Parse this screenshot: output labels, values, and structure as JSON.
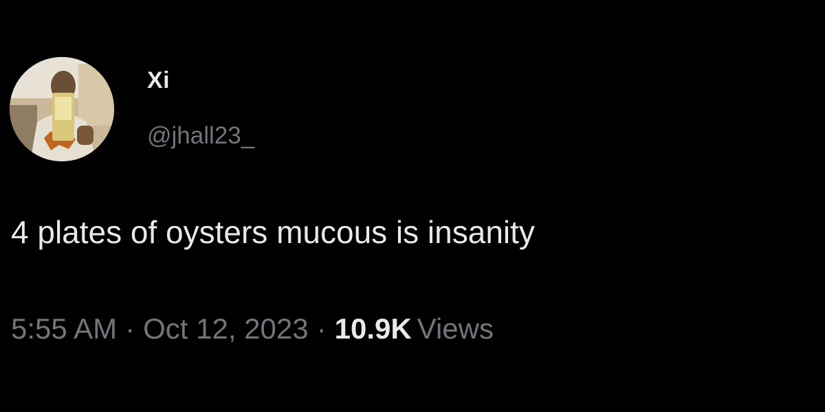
{
  "tweet": {
    "author": {
      "display_name": "Xi",
      "handle": "@jhall23_",
      "avatar_icon": "profile-photo"
    },
    "text": "4 plates of oysters mucous is insanity",
    "meta": {
      "time": "5:55 AM",
      "separator": "·",
      "date": "Oct 12, 2023",
      "views_count": "10.9K",
      "views_label": "Views"
    }
  },
  "colors": {
    "background": "#000000",
    "primary_text": "#e7e9ea",
    "secondary_text": "#71767b"
  }
}
